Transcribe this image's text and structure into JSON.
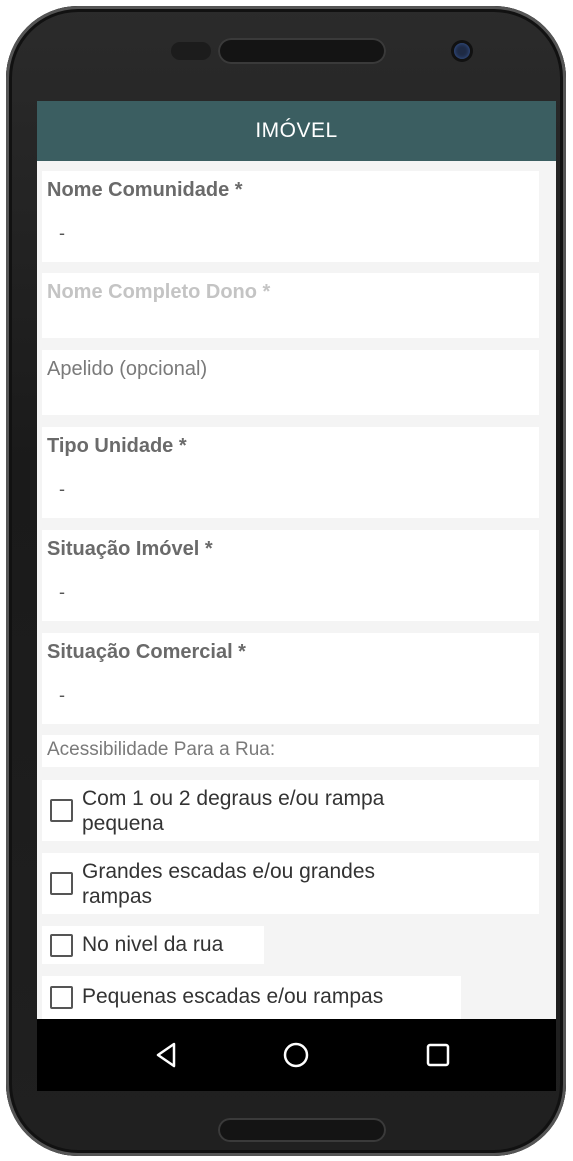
{
  "appbar": {
    "title": "IMÓVEL"
  },
  "form": {
    "nome_comunidade": {
      "label": "Nome Comunidade *",
      "value": "-"
    },
    "nome_dono": {
      "placeholder": "Nome Completo Dono *"
    },
    "apelido": {
      "placeholder": "Apelido (opcional)"
    },
    "tipo_unidade": {
      "label": "Tipo Unidade *",
      "value": "-"
    },
    "situacao_imovel": {
      "label": "Situação Imóvel *",
      "value": "-"
    },
    "situacao_comercial": {
      "label": "Situação Comercial *",
      "value": "-"
    },
    "acessibilidade": {
      "label": "Acessibilidade Para a Rua:",
      "options": [
        {
          "line1": "Com 1 ou 2 degraus e/ou rampa",
          "line2": "pequena",
          "checked": false
        },
        {
          "line1": "Grandes escadas e/ou grandes",
          "line2": "rampas",
          "checked": false
        },
        {
          "line1": "No nivel da rua",
          "checked": false
        },
        {
          "line1": "Pequenas escadas e/ou rampas",
          "checked": false
        }
      ]
    }
  },
  "navbar": {
    "icons": [
      "back-icon",
      "home-icon",
      "recents-icon"
    ]
  },
  "colors": {
    "appbar": "#3b5e61",
    "screen_bg": "#f4f4f4",
    "navbar": "#000000"
  }
}
